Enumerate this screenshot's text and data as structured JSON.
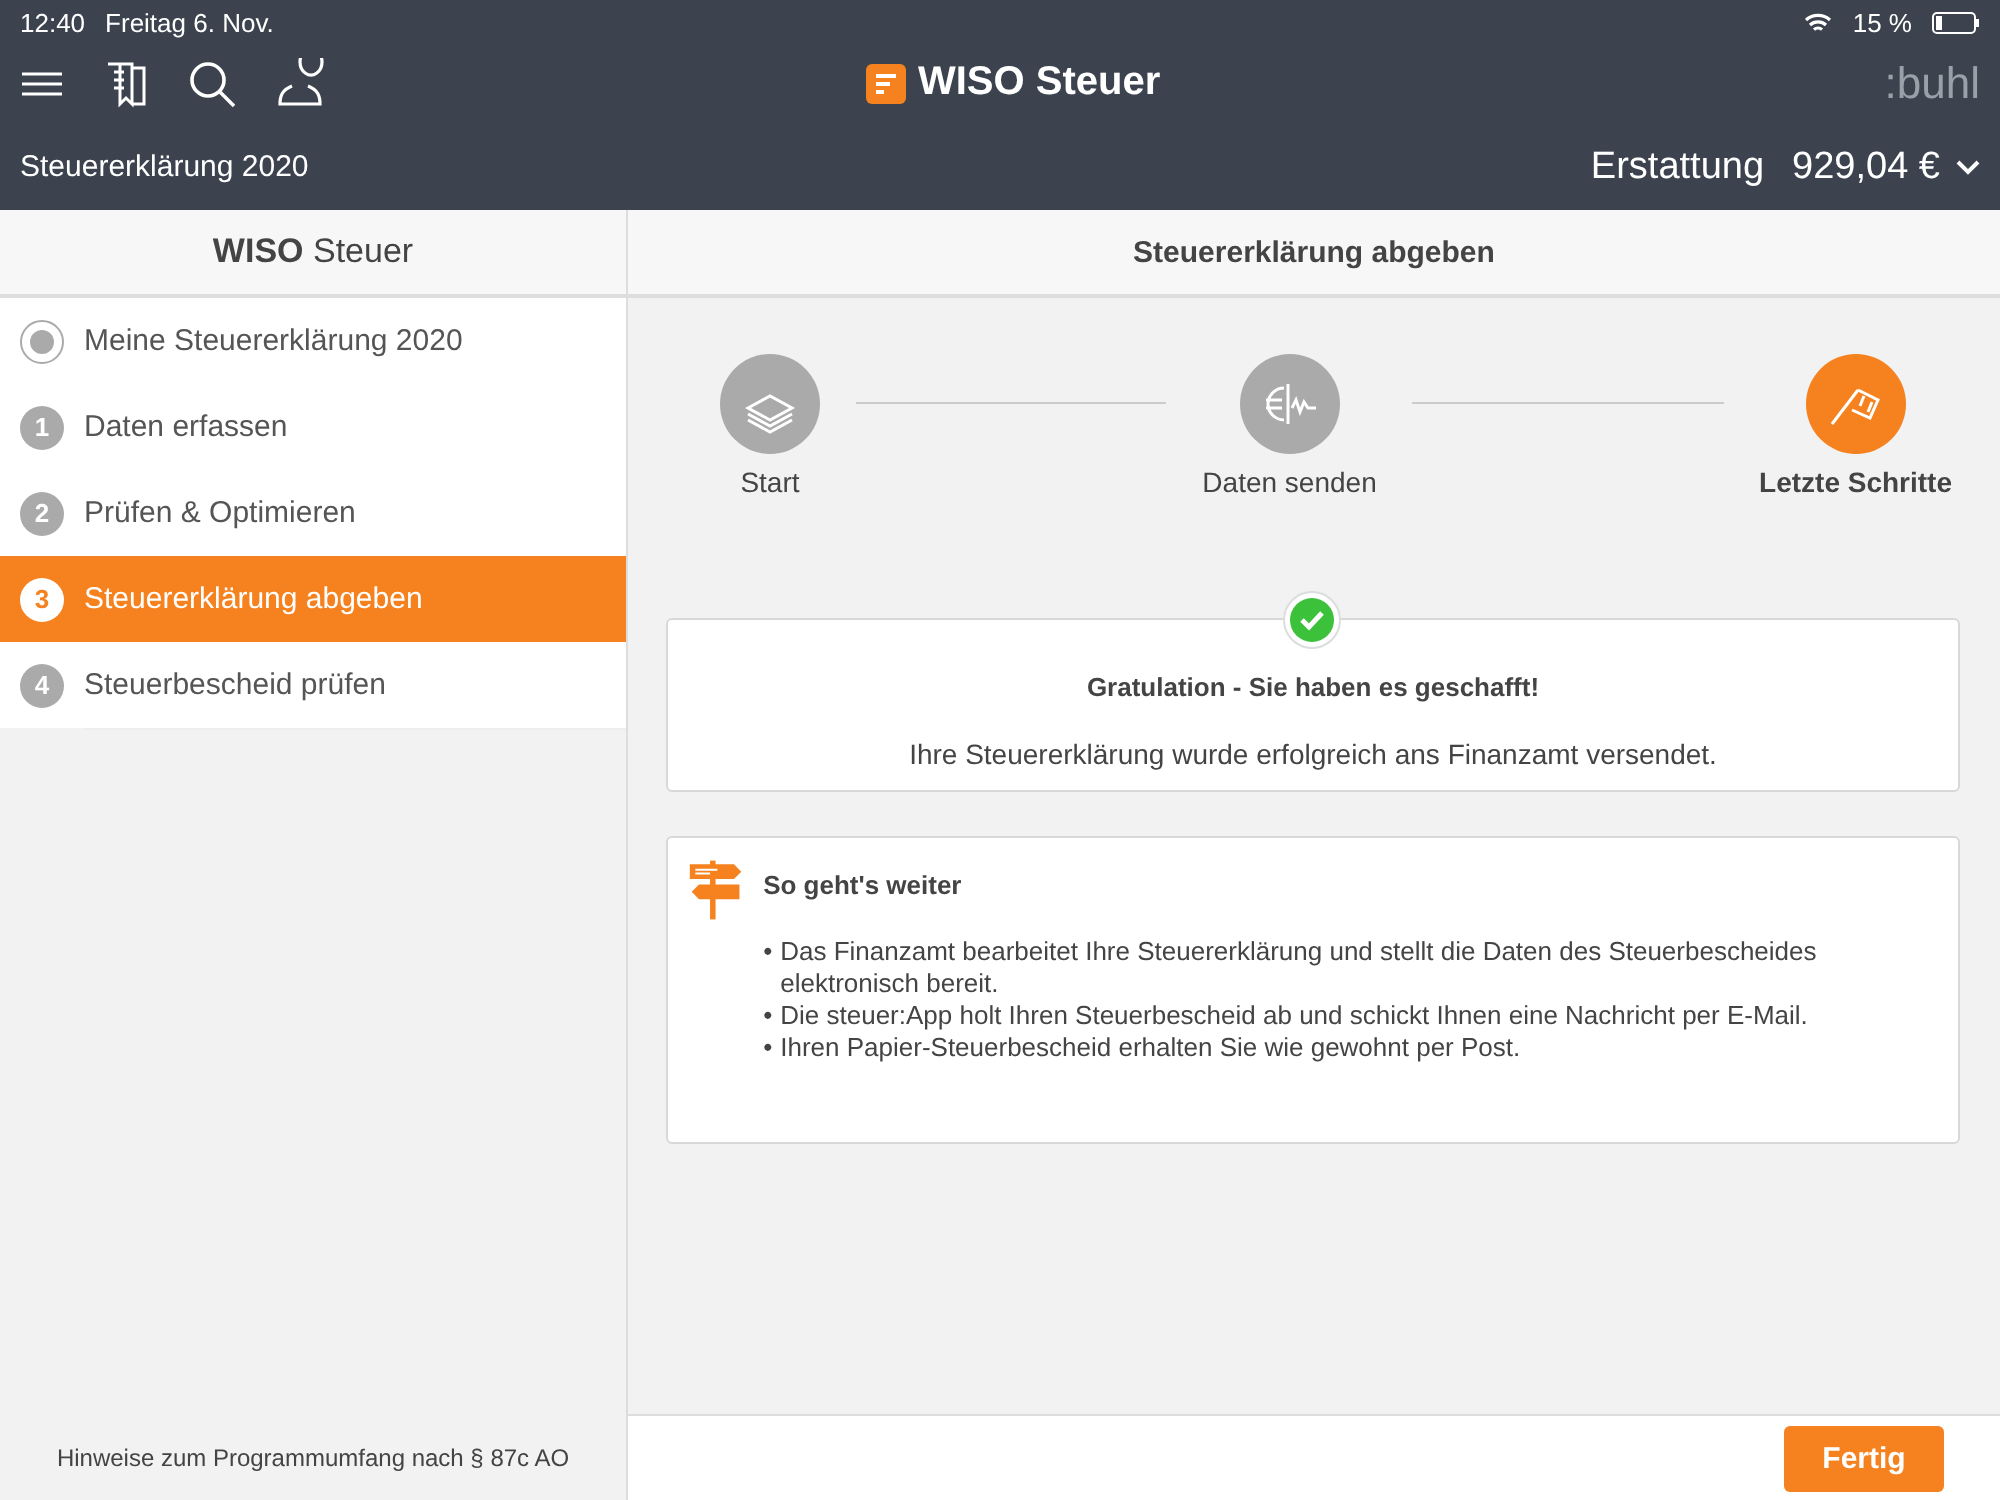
{
  "status_bar": {
    "time": "12:40",
    "date": "Freitag 6. Nov.",
    "battery": "15 %"
  },
  "header": {
    "logo": "WISO Steuer",
    "brand": ":buhl",
    "document": "Steuererklärung 2020",
    "refund_label": "Erstattung",
    "refund_amount": "929,04 €"
  },
  "sidebar": {
    "title": "**WISO** Steuer",
    "items": [
      {
        "kind": "radio",
        "marker": "",
        "label": "Meine Steuererklärung 2020",
        "selected": false
      },
      {
        "kind": "number",
        "marker": "1",
        "label": "Daten erfassen",
        "selected": false
      },
      {
        "kind": "number",
        "marker": "2",
        "label": "Prüfen & Optimieren",
        "selected": false
      },
      {
        "kind": "number",
        "marker": "3",
        "label": "Steuererklärung abgeben",
        "selected": true
      },
      {
        "kind": "number",
        "marker": "4",
        "label": "Steuerbescheid prüfen",
        "selected": false
      }
    ],
    "footer": "Hinweise zum Programmumfang nach § 87c AO"
  },
  "main": {
    "title": "Steuererklärung abgeben",
    "steps": [
      {
        "kind": "documents",
        "label": "Start",
        "selected": false
      },
      {
        "kind": "euro",
        "label": "Daten senden",
        "selected": false
      },
      {
        "kind": "flag",
        "label": "Letzte Schritte",
        "selected": true
      }
    ],
    "success": {
      "title": "Gratulation - Sie haben es geschafft!",
      "text": "Ihre Steuererklärung wurde erfolgreich ans Finanzamt versendet."
    },
    "next": {
      "title": "So geht's weiter",
      "items": [
        {
          "bullet": "•",
          "text": "Das Finanzamt bearbeitet Ihre Steuererklärung und stellt die Daten des Steuerbescheides elektronisch bereit."
        },
        {
          "bullet": "•",
          "text": "Die steuer:App holt Ihren Steuerbescheid ab und schickt Ihnen eine Nachricht per E-Mail."
        },
        {
          "bullet": "•",
          "text": "Ihren Papier-Steuerbescheid erhalten Sie wie gewohnt per Post."
        }
      ]
    },
    "button": "Fertig"
  }
}
